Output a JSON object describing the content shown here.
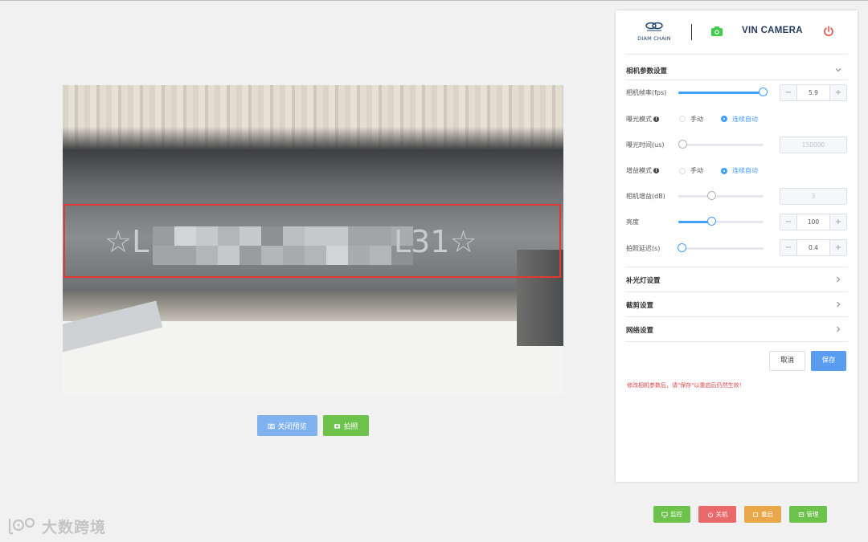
{
  "preview": {
    "vin_prefix": "☆L",
    "vin_suffix": "L31☆",
    "close_preview_label": "关闭预览",
    "capture_label": "拍照"
  },
  "header": {
    "logo_text": "DIAM CHAIN",
    "title": "VIN CAMERA"
  },
  "params": {
    "title": "相机参数设置",
    "frame_rate": {
      "label": "相机帧率(fps)",
      "value": "5.9",
      "level": 1.0
    },
    "exposure_mode": {
      "label": "曝光模式",
      "opt_manual": "手动",
      "opt_auto": "连续自动",
      "selected": "auto"
    },
    "exposure_time": {
      "label": "曝光时间(us)",
      "value": "150000",
      "level": 0.0
    },
    "gain_mode": {
      "label": "增益模式",
      "opt_manual": "手动",
      "opt_auto": "连续自动",
      "selected": "auto"
    },
    "camera_gain": {
      "label": "相机增益(dB)",
      "value": "3",
      "level": 0.4
    },
    "brightness": {
      "label": "亮度",
      "value": "100",
      "level": 0.4
    },
    "capture_delay": {
      "label": "拍照延迟(s)",
      "value": "0.4",
      "level": 0.0
    },
    "minus": "−",
    "plus": "+"
  },
  "sections": {
    "fill_light": "补光灯设置",
    "crop": "截剪设置",
    "network": "网络设置"
  },
  "actions": {
    "cancel": "取消",
    "save": "保存",
    "warning": "修改相机参数后，请\"保存\"以重启后仍然生效！"
  },
  "bottom": {
    "monitor": "监控",
    "shutdown": "关机",
    "restart": "重启",
    "manage": "管理"
  },
  "watermark": "大数跨境",
  "colors": {
    "primary": "#409eff",
    "green": "#6cc24a",
    "red": "#e86a6a",
    "orange": "#e8a84a",
    "alert_red": "#e03a2f"
  }
}
